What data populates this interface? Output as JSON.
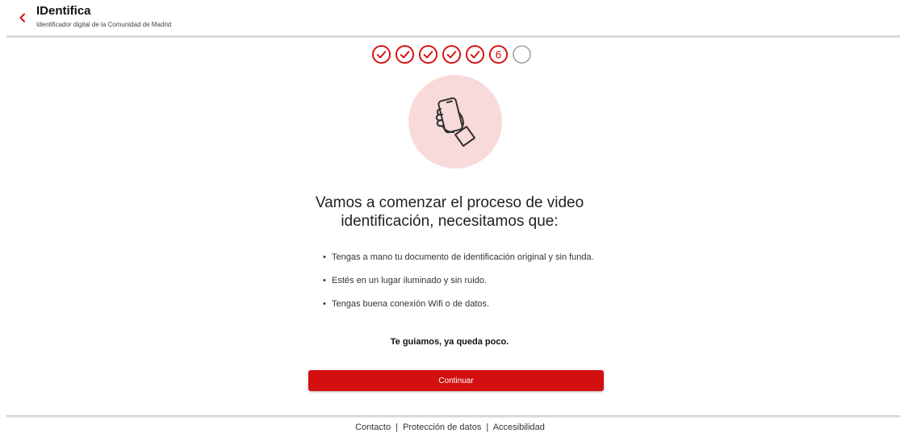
{
  "header": {
    "back_icon": "chevron-left-icon",
    "title": "IDentifica",
    "subtitle": "Identificador digital de la Comunidad de Madrid"
  },
  "colors": {
    "accent": "#d30f10",
    "hero_bg": "#f9dadb",
    "pending_step": "#9a9a9a"
  },
  "steps": {
    "completed_count": 5,
    "current_label": "6",
    "pending_count": 1
  },
  "hero_icon": "hand-holding-phone-icon",
  "main": {
    "heading_line1": "Vamos a comenzar el proceso de video",
    "heading_line2": "identificación, necesitamos que:",
    "bullets": [
      "Tengas a mano tu documento de identificación original y sin funda.",
      "Estés en un lugar iluminado y sin ruido.",
      "Tengas buena conexión Wifi o de datos."
    ],
    "guide_text": "Te guiamos, ya queda poco.",
    "continue_label": "Continuar"
  },
  "footer": {
    "links": [
      "Contacto",
      "Protección de datos",
      "Accesibilidad"
    ],
    "separator": "|"
  }
}
